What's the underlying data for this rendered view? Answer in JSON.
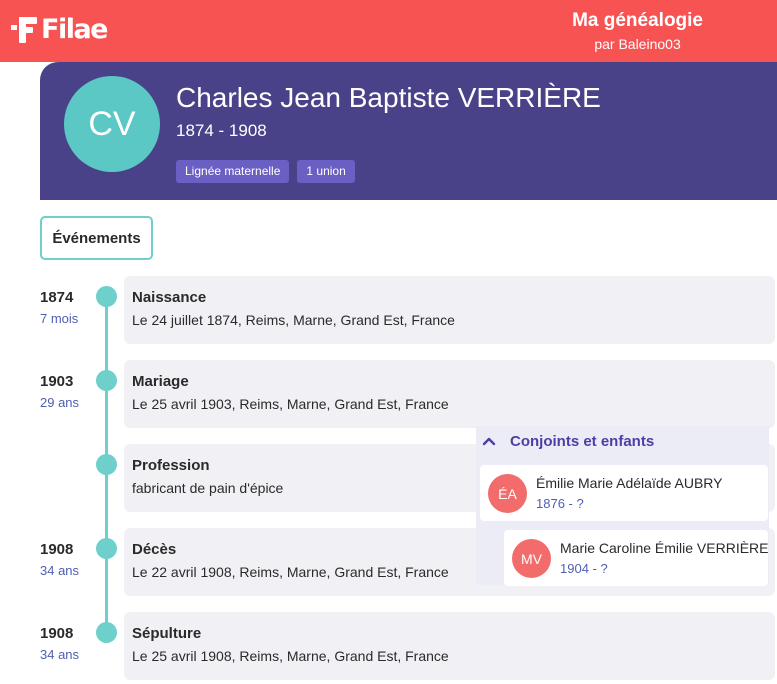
{
  "header": {
    "logo_text": "Filae",
    "title": "Ma généalogie",
    "subtitle": "par Baleino03",
    "color": "#f75353"
  },
  "person": {
    "initials": "CV",
    "name": "Charles Jean Baptiste VERRIÈRE",
    "dates": "1874 - 1908",
    "badges": [
      "Lignée maternelle",
      "1 union"
    ],
    "banner_color": "#4a4288"
  },
  "events_tab": {
    "label": "Événements"
  },
  "events": [
    {
      "year": "1874",
      "age": "7 mois",
      "title": "Naissance",
      "detail": "Le 24 juillet 1874, Reims, Marne, Grand Est, France"
    },
    {
      "year": "1903",
      "age": "29 ans",
      "title": "Mariage",
      "detail": "Le 25 avril 1903, Reims, Marne, Grand Est, France"
    },
    {
      "year": "",
      "age": "",
      "title": "Profession",
      "detail": "fabricant de pain d'épice"
    },
    {
      "year": "1908",
      "age": "34 ans",
      "title": "Décès",
      "detail": "Le 22 avril 1908, Reims, Marne, Grand Est, France"
    },
    {
      "year": "1908",
      "age": "34 ans",
      "title": "Sépulture",
      "detail": "Le 25 avril 1908, Reims, Marne, Grand Est, France"
    }
  ],
  "family": {
    "heading": "Conjoints et enfants",
    "expand_icon": "chevron-up-icon",
    "spouse": {
      "initials": "ÉA",
      "name": "Émilie Marie Adélaïde AUBRY",
      "dates": "1876 - ?"
    },
    "child": {
      "initials": "MV",
      "name": "Marie Caroline Émilie VERRIÈRE",
      "dates": "1904 - ?"
    }
  }
}
